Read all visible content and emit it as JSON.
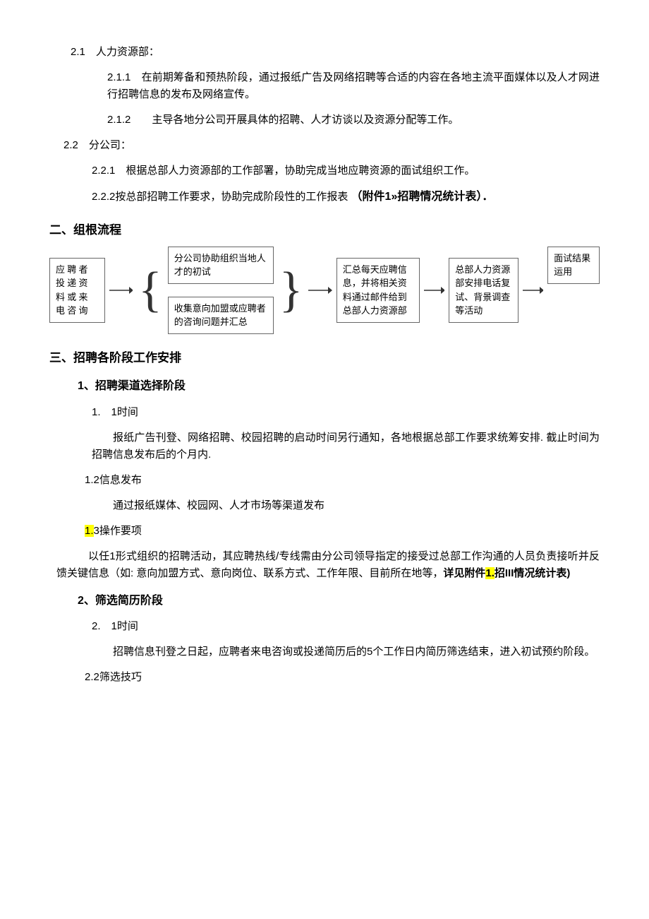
{
  "s21_num": "2.1",
  "s21_title": "人力资源部：",
  "s211": "2.1.1　在前期筹备和预热阶段，通过报纸广告及网络招聘等合适的内容在各地主流平面媒体以及人才网进行招聘信息的发布及网络宣传。",
  "s212": "2.1.2　　主导各地分公司开展具体的招聘、人才访谈以及资源分配等工作。",
  "s22_num": "2.2",
  "s22_title": "分公司：",
  "s221": "2.2.1　根据总部人力资源部的工作部署，协助完成当地应聘资源的面试组织工作。",
  "s222_a": "2.2.2按总部招聘工作要求，协助完成阶段性的工作报表",
  "s222_b": "（附件1»招聘情况统计表）．",
  "h2": "二、组根流程",
  "flow": {
    "b1": "应 聘 者\n投 递 资\n料 或 来\n电 咨 询",
    "b2a": "分公司协助组织当地人才的初试",
    "b2b": "收集意向加盟或应聘者的咨询问题并汇总",
    "b3": "汇总每天应聘信息，并将相关资料通过邮件给到总部人力资源部",
    "b4": "总部人力资源部安排电话复试、背景调查等活动",
    "b5": "面试结果运用"
  },
  "h3": "三、招聘各阶段工作安排",
  "h3_1": "1、招聘渠道选择阶段",
  "p1_1": "1.　1时间",
  "p1_1_body": "报纸广告刊登、网络招聘、校园招聘的启动时间另行通知，各地根据总部工作要求统筹安排. 截止时间为招聘信息发布后的个月内.",
  "p1_2": "1.2信息发布",
  "p1_2_body": "通过报纸媒体、校园网、人才市场等渠道发布",
  "p1_3_hl": "1.",
  "p1_3_rest": "3操作要项",
  "p1_3_body_a": "以任1形式组织的招聘活动，其应聘热线/专线需由分公司领导指定的接受过总部工作沟通的人员负责接听并反馈关键信息（如: 意向加盟方式、意向岗位、联系方式、工作年限、目前所在地等，",
  "p1_3_body_b": "详见附件",
  "p1_3_body_hl": "1.",
  "p1_3_body_c": "招III情况统计表)",
  "h3_2": "2、筛选简历阶段",
  "p2_1": "2.　1时间",
  "p2_1_body": "招聘信息刊登之日起，应聘者来电咨询或投递简历后的5个工作日内简历筛选结束，进入初试预约阶段。",
  "p2_2": "2.2筛选技巧"
}
